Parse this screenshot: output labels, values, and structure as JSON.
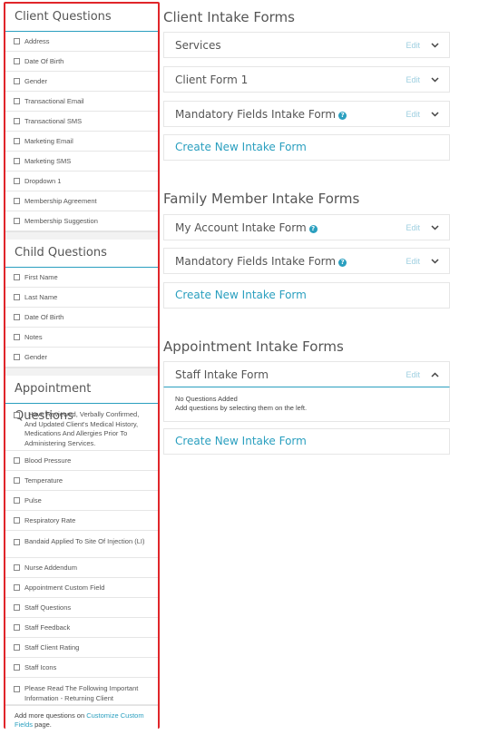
{
  "client_questions": {
    "title": "Client Questions",
    "items": [
      "Address",
      "Date Of Birth",
      "Gender",
      "Transactional Email",
      "Transactional SMS",
      "Marketing Email",
      "Marketing SMS",
      "Dropdown 1",
      "Membership Agreement",
      "Membership Suggestion"
    ]
  },
  "child_questions": {
    "title": "Child Questions",
    "items": [
      "First Name",
      "Last Name",
      "Date Of Birth",
      "Notes",
      "Gender"
    ]
  },
  "appointment_questions": {
    "title": "Appointment Questions",
    "items": [
      "I Have Reviewed, Verbally Confirmed, And Updated Client's Medical History, Medications And Allergies Prior To Administering Services.",
      "Blood Pressure",
      "Temperature",
      "Pulse",
      "Respiratory Rate",
      "Bandaid Applied To Site Of Injection (LI)",
      "Nurse Addendum",
      "Appointment Custom Field",
      "Staff Questions",
      "Staff Feedback",
      "Staff Client Rating",
      "Staff Icons",
      "Please Read The Following Important Information - Returning Client"
    ]
  },
  "footer": {
    "prefix": "Add more questions on ",
    "link": "Customize Custom Fields",
    "suffix": " page."
  },
  "client_forms": {
    "title": "Client Intake Forms",
    "forms": [
      "Services",
      "Client Form 1",
      "Mandatory Fields Intake Form"
    ],
    "create": "Create New Intake Form"
  },
  "family_forms": {
    "title": "Family Member Intake Forms",
    "forms": [
      "My Account Intake Form",
      "Mandatory Fields Intake Form"
    ],
    "create": "Create New Intake Form"
  },
  "appointment_forms": {
    "title": "Appointment Intake Forms",
    "forms": [
      "Staff Intake Form"
    ],
    "empty_title": "No Questions Added",
    "empty_hint": "Add questions by selecting them on the left.",
    "create": "Create New Intake Form"
  },
  "edit_label": "Edit",
  "help_glyph": "?",
  "colors": {
    "accent": "#2a9fbf",
    "highlight_border": "#e0252a"
  }
}
